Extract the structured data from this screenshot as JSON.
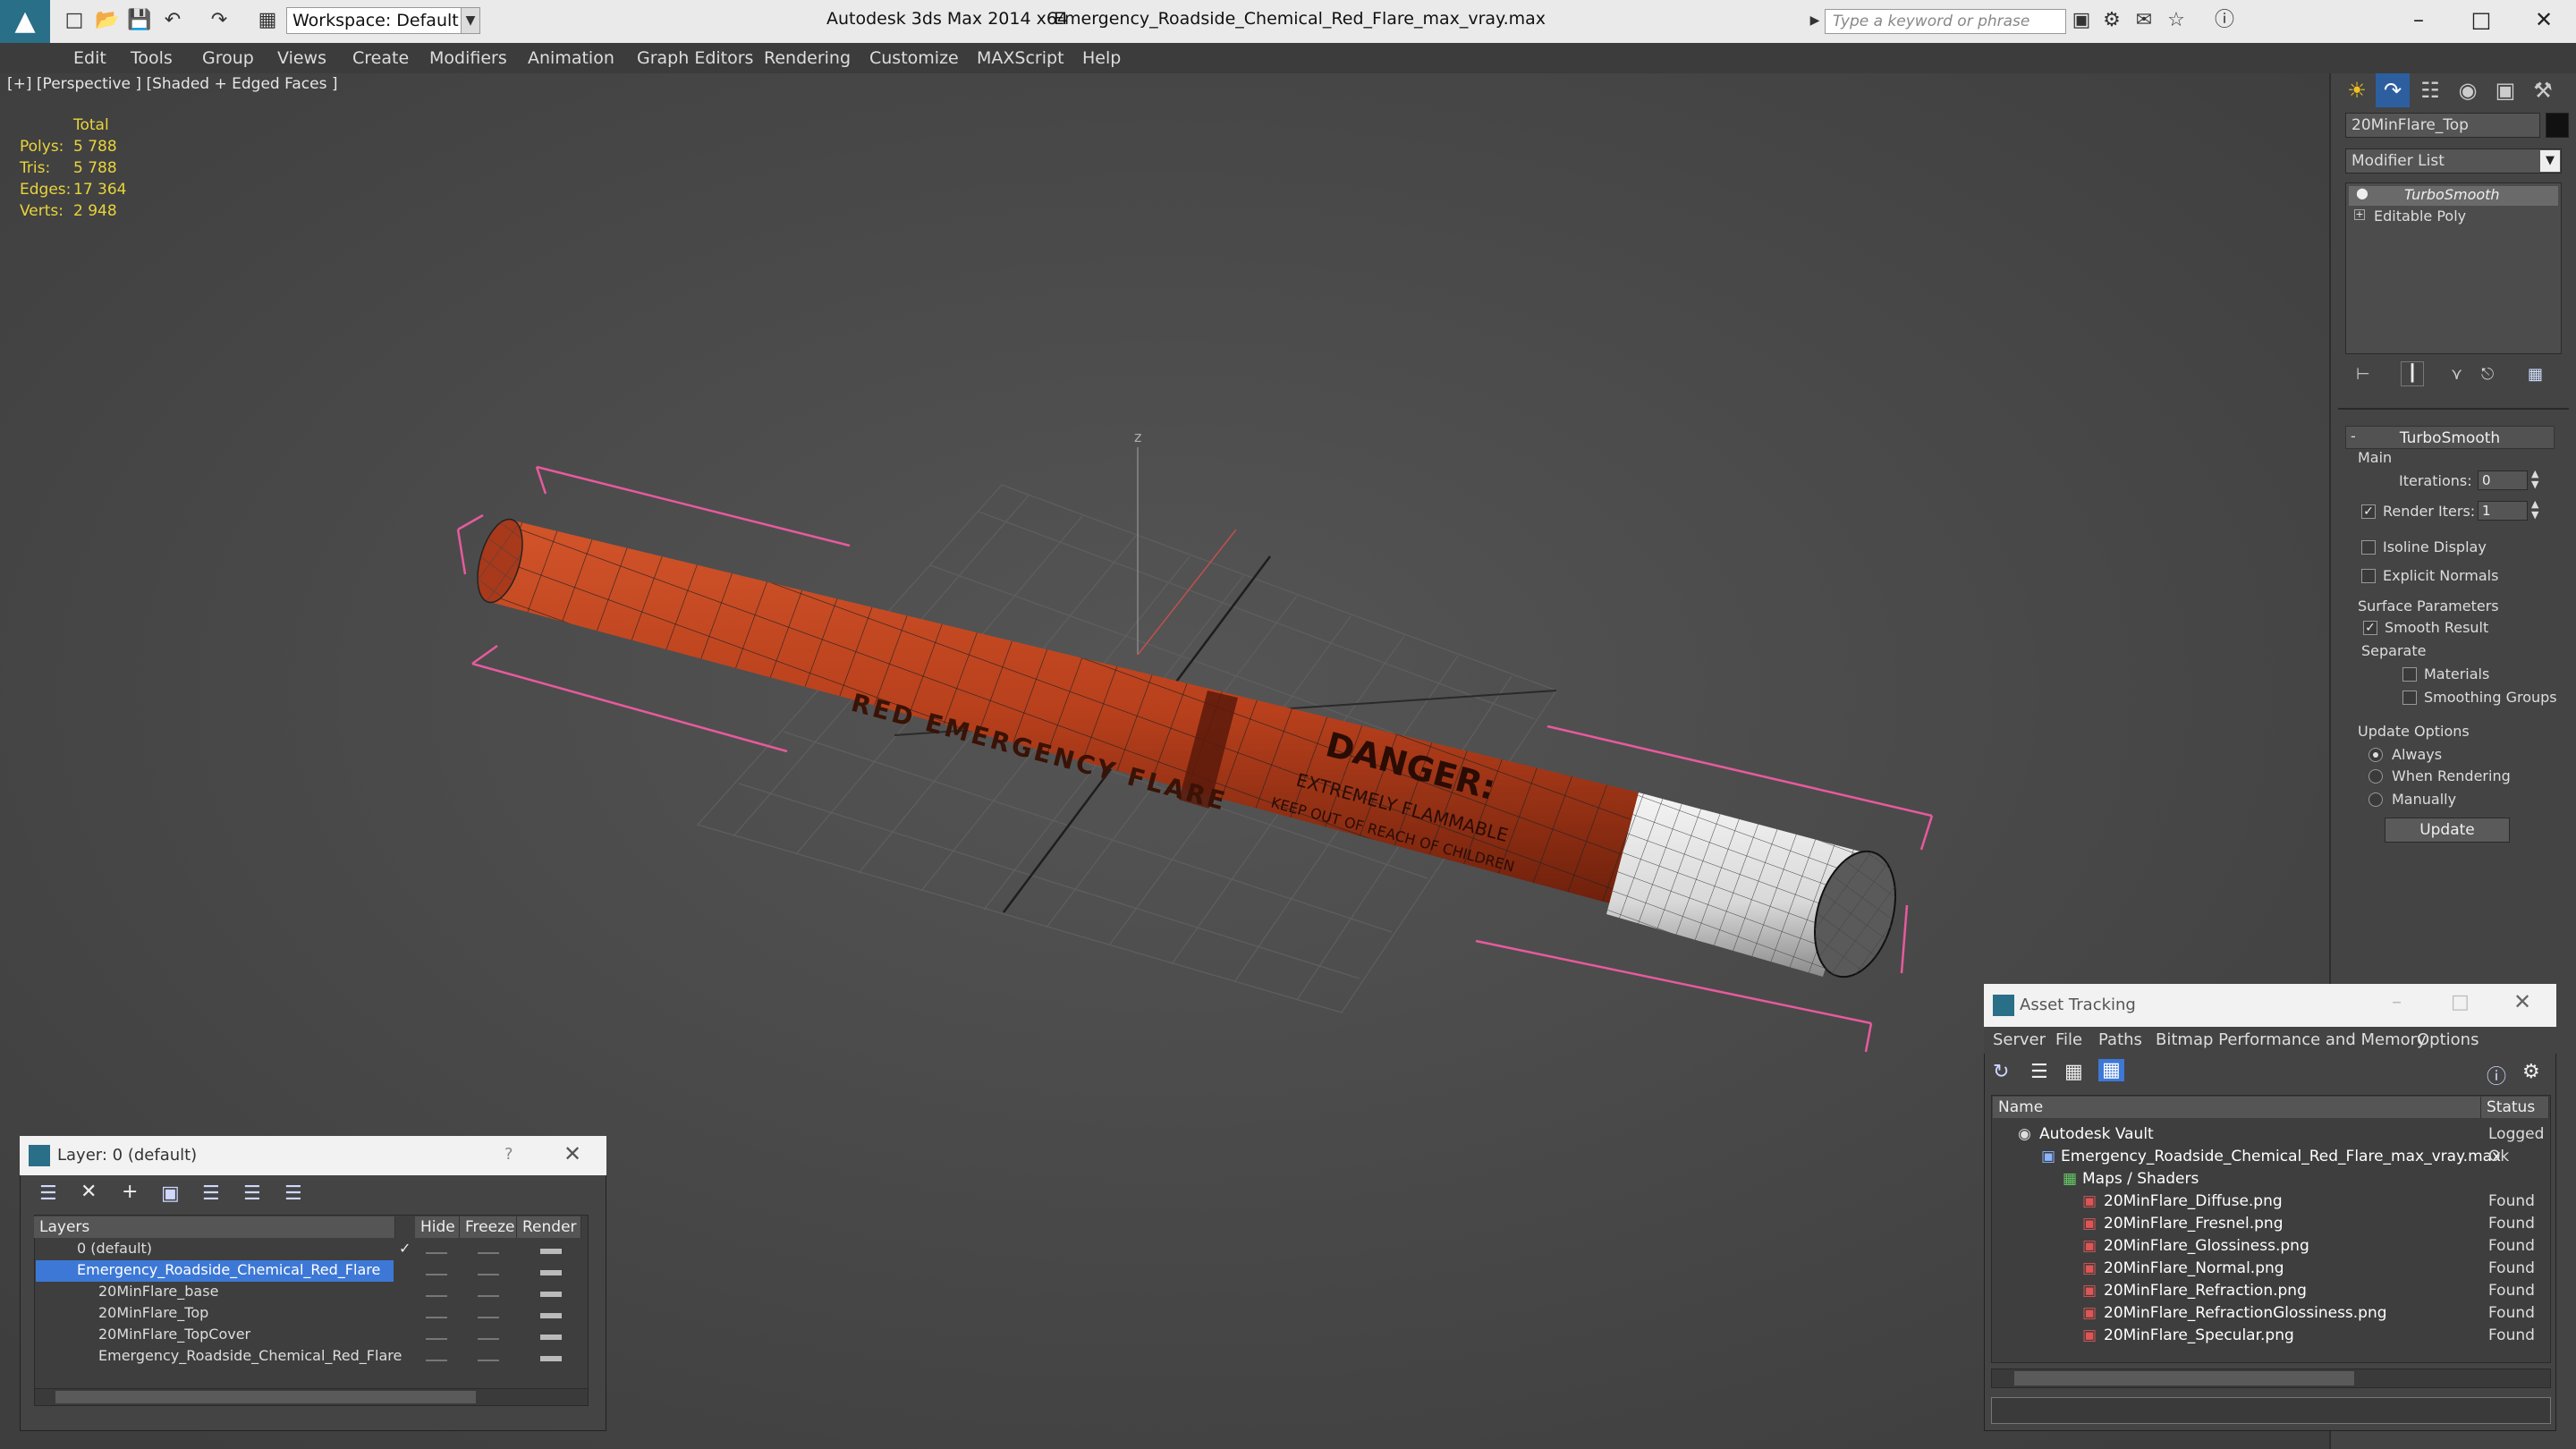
{
  "app": {
    "title": "Autodesk 3ds Max  2014 x64",
    "file": "Emergency_Roadside_Chemical_Red_Flare_max_vray.max",
    "workspace": "Workspace: Default",
    "search_placeholder": "Type a keyword or phrase"
  },
  "menu": [
    "Edit",
    "Tools",
    "Group",
    "Views",
    "Create",
    "Modifiers",
    "Animation",
    "Graph Editors",
    "Rendering",
    "Customize",
    "MAXScript",
    "Help"
  ],
  "viewport": {
    "label": "[+] [Perspective ] [Shaded + Edged Faces ]",
    "stats": {
      "header": "Total",
      "rows": [
        {
          "label": "Polys:",
          "value": "5 788"
        },
        {
          "label": "Tris:",
          "value": "5 788"
        },
        {
          "label": "Edges:",
          "value": "17 364"
        },
        {
          "label": "Verts:",
          "value": "2 948"
        }
      ]
    },
    "axis_label": "z",
    "flare_text": {
      "main": "RED EMERGENCY FLARE",
      "danger": "DANGER:",
      "line1": "EXTREMELY FLAMMABLE",
      "line2": "KEEP OUT OF REACH OF CHILDREN"
    }
  },
  "command_panel": {
    "object_name": "20MinFlare_Top",
    "modifier_list": "Modifier List",
    "stack": [
      "TurboSmooth",
      "Editable Poly"
    ],
    "turbosmooth": {
      "title": "TurboSmooth",
      "main": "Main",
      "iterations_label": "Iterations:",
      "iterations": "0",
      "render_iters_label": "Render Iters:",
      "render_iters": "1",
      "isoline": "Isoline Display",
      "explicit": "Explicit Normals",
      "surface": "Surface Parameters",
      "smooth_result": "Smooth Result",
      "separate": "Separate",
      "materials": "Materials",
      "smoothing_groups": "Smoothing Groups",
      "update_options": "Update Options",
      "always": "Always",
      "when_rendering": "When Rendering",
      "manually": "Manually",
      "update_btn": "Update"
    }
  },
  "layer_panel": {
    "title": "Layer: 0 (default)",
    "help": "?",
    "columns": [
      "Layers",
      "Hide",
      "Freeze",
      "Render"
    ],
    "rows": [
      "0 (default)",
      "Emergency_Roadside_Chemical_Red_Flare",
      "20MinFlare_base",
      "20MinFlare_Top",
      "20MinFlare_TopCover",
      "Emergency_Roadside_Chemical_Red_Flare"
    ]
  },
  "asset_tracking": {
    "title": "Asset Tracking",
    "menu": [
      "Server",
      "File",
      "Paths",
      "Bitmap Performance and Memory",
      "Options"
    ],
    "columns": [
      "Name",
      "Status"
    ],
    "rows": [
      {
        "name": "Autodesk Vault",
        "status": "Logged"
      },
      {
        "name": "Emergency_Roadside_Chemical_Red_Flare_max_vray.max",
        "status": "Ok"
      },
      {
        "name": "Maps / Shaders",
        "status": ""
      },
      {
        "name": "20MinFlare_Diffuse.png",
        "status": "Found"
      },
      {
        "name": "20MinFlare_Fresnel.png",
        "status": "Found"
      },
      {
        "name": "20MinFlare_Glossiness.png",
        "status": "Found"
      },
      {
        "name": "20MinFlare_Normal.png",
        "status": "Found"
      },
      {
        "name": "20MinFlare_Refraction.png",
        "status": "Found"
      },
      {
        "name": "20MinFlare_RefractionGlossiness.png",
        "status": "Found"
      },
      {
        "name": "20MinFlare_Specular.png",
        "status": "Found"
      }
    ]
  },
  "colors": {
    "flare_red": "#b8401c",
    "selection_blue": "#3d78d6",
    "stat_yellow": "#e8d43b",
    "bbox_pink": "#e75a9e"
  }
}
